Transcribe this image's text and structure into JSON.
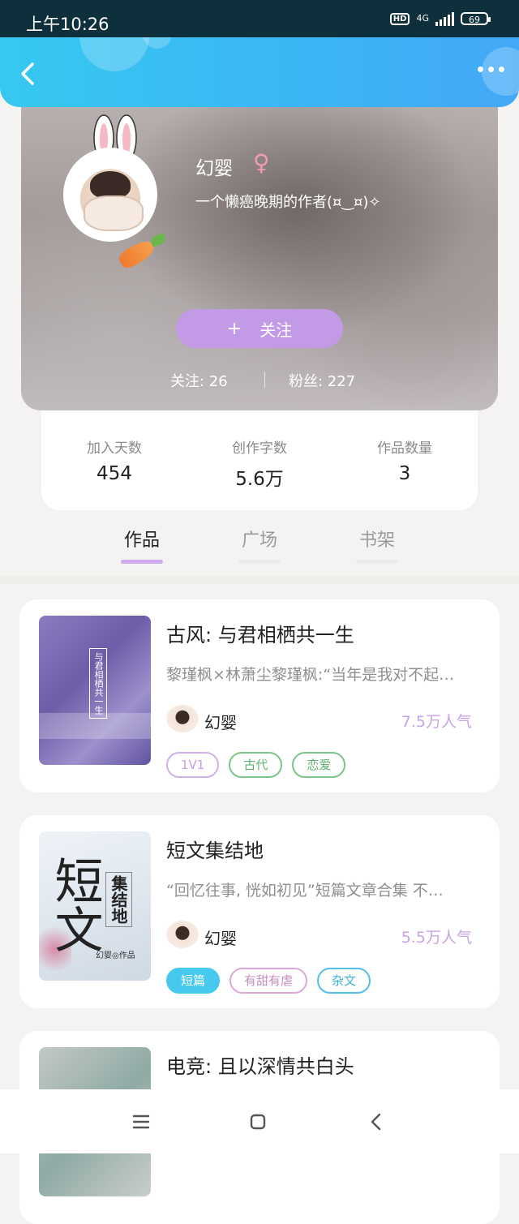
{
  "status_bar": {
    "time": "上午10:26",
    "hd": "HD",
    "network": "4G",
    "battery": "69"
  },
  "nav": {
    "back_icon": "chevron-left-icon",
    "more_icon": "more-dots-icon"
  },
  "profile": {
    "name": "幻婴",
    "gender_symbol": "♀",
    "bio": "一个懒癌晚期的作者(¤‿¤)✧",
    "follow_plus": "+",
    "follow_label": "关注",
    "following_text": "关注: 26",
    "followers_text": "粉丝: 227"
  },
  "stats": [
    {
      "label": "加入天数",
      "value": "454"
    },
    {
      "label": "创作字数",
      "value": "5.6万"
    },
    {
      "label": "作品数量",
      "value": "3"
    }
  ],
  "tabs": [
    {
      "label": "作品",
      "active": true
    },
    {
      "label": "广场",
      "active": false
    },
    {
      "label": "书架",
      "active": false
    }
  ],
  "books": [
    {
      "title": "古风: 与君相栖共一生",
      "description": "黎瑾枫×林萧尘黎瑾枫:“当年是我对不起…",
      "author": "幻婴",
      "popularity": "7.5万人气",
      "cover_text": "与君相栖共一生",
      "tags": [
        "1V1",
        "古代",
        "恋爱"
      ]
    },
    {
      "title": "短文集结地",
      "description": "“回忆往事, 恍如初见”短篇文章合集 不…",
      "author": "幻婴",
      "popularity": "5.5万人气",
      "cover_title": "短文",
      "cover_sub": "集结地",
      "cover_credit": "幻婴◎作品",
      "tags": [
        "短篇",
        "有甜有虐",
        "杂文"
      ]
    },
    {
      "title": "电竞: 且以深情共白头"
    }
  ],
  "colors": {
    "accent_purple": "#c39ae6",
    "nav_blue": "#3ab8f5",
    "popularity": "#c8a3e6"
  }
}
